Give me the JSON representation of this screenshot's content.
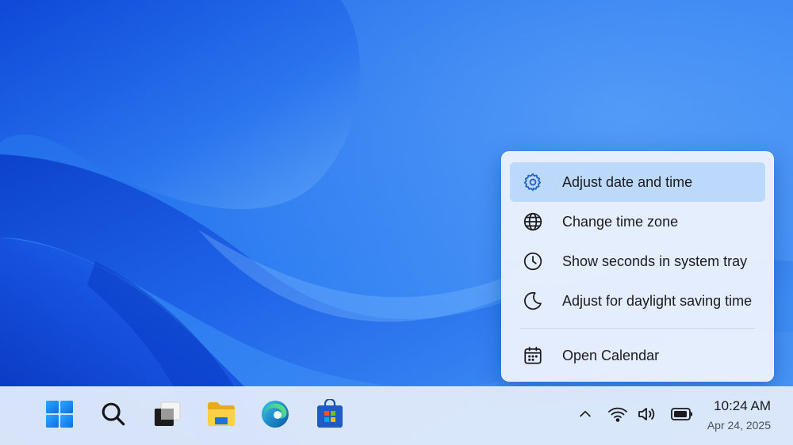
{
  "context_menu": {
    "items": [
      {
        "label": "Adjust date and time",
        "icon": "gear-icon",
        "highlighted": true
      },
      {
        "label": "Change time zone",
        "icon": "globe-icon",
        "highlighted": false
      },
      {
        "label": "Show seconds in system tray",
        "icon": "clock-icon",
        "highlighted": false
      },
      {
        "label": "Adjust for daylight saving time",
        "icon": "moon-icon",
        "highlighted": false
      },
      {
        "label": "Open Calendar",
        "icon": "calendar-icon",
        "highlighted": false
      }
    ]
  },
  "taskbar": {
    "apps": [
      {
        "name": "start",
        "icon": "windows-logo-icon"
      },
      {
        "name": "search",
        "icon": "search-icon"
      },
      {
        "name": "task-view",
        "icon": "task-view-icon"
      },
      {
        "name": "file-explorer",
        "icon": "folder-icon"
      },
      {
        "name": "edge",
        "icon": "edge-browser-icon"
      },
      {
        "name": "store",
        "icon": "store-bag-icon"
      }
    ],
    "tray": {
      "icons": [
        "chevron-up-icon",
        "wifi-icon",
        "volume-icon",
        "battery-icon"
      ]
    },
    "clock": {
      "time": "10:24 AM",
      "date": "Apr 24, 2025"
    }
  },
  "colors": {
    "wallpaper_base": "#2f7ff2",
    "wallpaper_deep": "#0b3fc9",
    "menu_background": "#e9f1fd",
    "menu_highlight": "#bcd8fb",
    "taskbar_background": "#e0eafa",
    "accent": "#1f5fbf"
  }
}
